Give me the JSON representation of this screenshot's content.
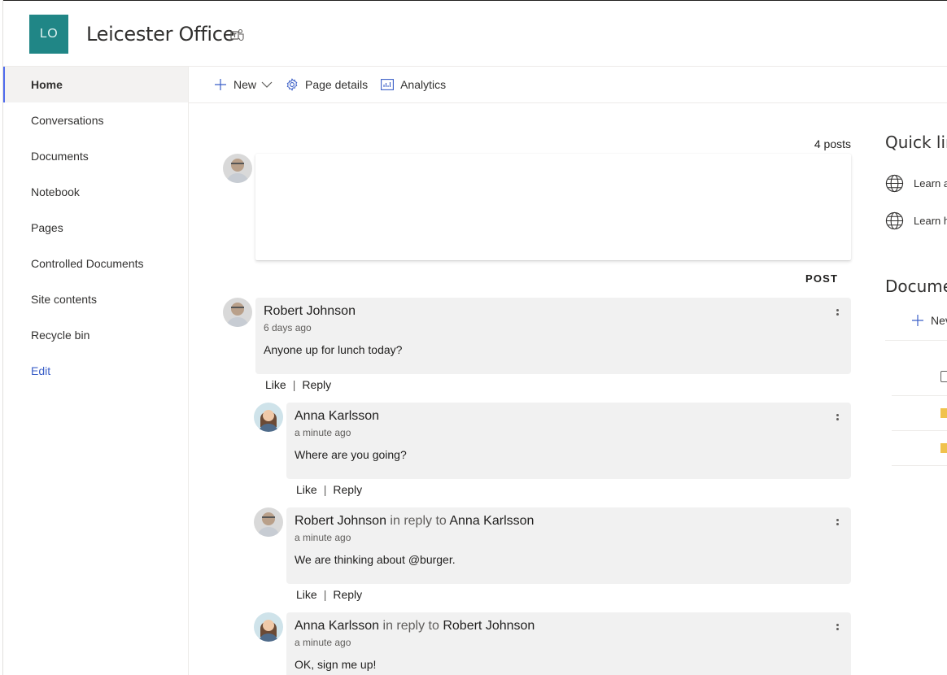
{
  "site": {
    "logo_text": "LO",
    "title": "Leicester Office",
    "logo_color": "#208686"
  },
  "nav": {
    "items": [
      {
        "label": "Home",
        "active": true
      },
      {
        "label": "Conversations"
      },
      {
        "label": "Documents"
      },
      {
        "label": "Notebook"
      },
      {
        "label": "Pages"
      },
      {
        "label": "Controlled Documents"
      },
      {
        "label": "Site contents"
      },
      {
        "label": "Recycle bin"
      },
      {
        "label": "Edit"
      }
    ]
  },
  "commands": {
    "new_label": "New",
    "page_details_label": "Page details",
    "analytics_label": "Analytics"
  },
  "conversation": {
    "posts_count": "4 posts",
    "post_button": "POST",
    "like_label": "Like",
    "reply_label": "Reply",
    "in_reply_to": "in reply to",
    "posts": [
      {
        "author": "Robert Johnson",
        "time": "6 days ago",
        "text": "Anyone up for lunch today?"
      },
      {
        "author": "Anna Karlsson",
        "time": "a minute ago",
        "text": "Where are you going?"
      },
      {
        "author": "Robert Johnson",
        "reply_to": "Anna Karlsson",
        "time": "a minute ago",
        "text": "We are thinking about @burger."
      },
      {
        "author": "Anna Karlsson",
        "reply_to": "Robert Johnson",
        "time": "a minute ago",
        "text": "OK, sign me up!"
      }
    ]
  },
  "right": {
    "quick_links_title": "Quick lin",
    "links": [
      "Learn a",
      "Learn h"
    ],
    "documents_title": "Docume",
    "new_label": "Nev"
  },
  "colors": {
    "accent": "#4f6bed",
    "edit_link": "#3b5fc7",
    "folder": "#f0c24d"
  }
}
